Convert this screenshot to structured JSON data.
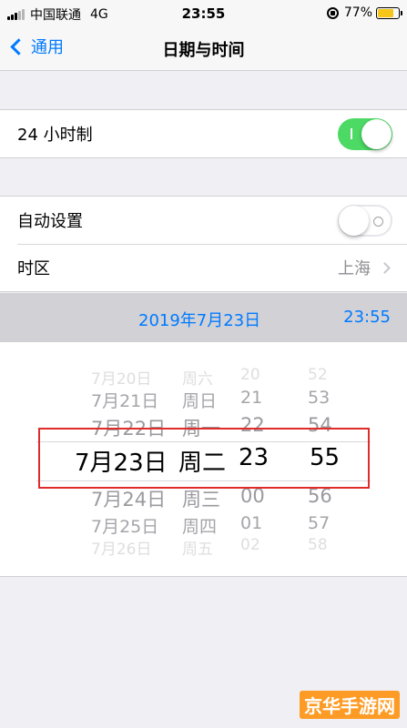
{
  "status": {
    "carrier": "中国联通",
    "network": "4G",
    "time": "23:55",
    "battery": "77%",
    "battery_level": 0.77,
    "battery_color": "#f5c518"
  },
  "nav": {
    "back_label": "通用",
    "title": "日期与时间"
  },
  "settings": {
    "hour24_label": "24 小时制",
    "hour24_on": true,
    "auto_label": "自动设置",
    "auto_on": false,
    "timezone_label": "时区",
    "timezone_value": "上海"
  },
  "selected": {
    "date": "2019年7月23日",
    "time": "23:55"
  },
  "picker": {
    "rows": [
      {
        "date": "7月20日",
        "weekday": "周六",
        "hour": "20",
        "minute": "52"
      },
      {
        "date": "7月21日",
        "weekday": "周日",
        "hour": "21",
        "minute": "53"
      },
      {
        "date": "7月22日",
        "weekday": "周一",
        "hour": "22",
        "minute": "54"
      },
      {
        "date": "7月23日",
        "weekday": "周二",
        "hour": "23",
        "minute": "55"
      },
      {
        "date": "7月24日",
        "weekday": "周三",
        "hour": "00",
        "minute": "56"
      },
      {
        "date": "7月25日",
        "weekday": "周四",
        "hour": "01",
        "minute": "57"
      },
      {
        "date": "7月26日",
        "weekday": "周五",
        "hour": "02",
        "minute": "58"
      }
    ]
  },
  "watermark": "京华手游网",
  "colors": {
    "accent": "#007aff",
    "toggle_on": "#4cd964",
    "highlight": "#e02b2b"
  }
}
